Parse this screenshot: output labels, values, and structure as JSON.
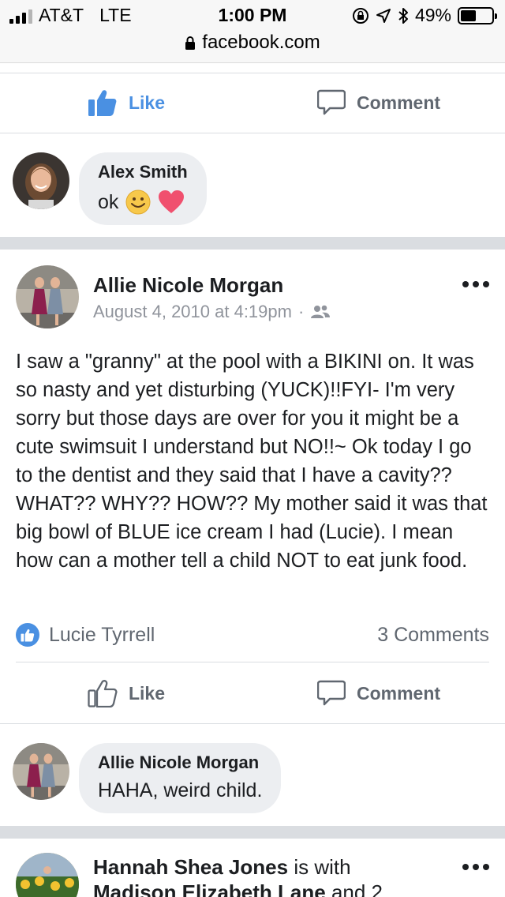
{
  "status_bar": {
    "carrier": "AT&T",
    "network": "LTE",
    "time": "1:00 PM",
    "battery": "49%",
    "battery_level": 0.49
  },
  "browser": {
    "url": "facebook.com"
  },
  "top_actions": {
    "like_label": "Like",
    "comment_label": "Comment"
  },
  "comment_1": {
    "author": "Alex Smith",
    "text": "ok",
    "emojis": [
      "smiley-emoji",
      "heart-emoji"
    ]
  },
  "post": {
    "author": "Allie Nicole Morgan",
    "timestamp": "August 4, 2010 at 4:19pm",
    "separator": "·",
    "audience_icon": "friends-icon",
    "body": "I saw a \"granny\" at the pool with a BIKINI on. It was so nasty and yet disturbing (YUCK)!!FYI- I'm very sorry but those days are over for you it might be a cute swimsuit I understand but NO!!~ Ok today I go to the dentist and they said that I have a cavity?? WHAT?? WHY?? HOW?? My mother said it was that big bowl of BLUE ice cream I had (Lucie). I mean how can a mother tell a child NOT to eat junk food.",
    "liked_by": "Lucie Tyrrell",
    "comments_count": "3 Comments",
    "like_label": "Like",
    "comment_label": "Comment"
  },
  "comment_2": {
    "author": "Allie Nicole Morgan",
    "text": "HAHA, weird child."
  },
  "next_post": {
    "author": "Hannah Shea Jones",
    "connector": "is with",
    "tagged": "Madison Elizabeth Lane",
    "tail": "and 2"
  },
  "colors": {
    "facebook_blue": "#4a90e2",
    "text_primary": "#1c1e21",
    "text_secondary": "#606770",
    "bubble_bg": "#eceef1",
    "separator": "#dadde1",
    "heart": "#f0506e",
    "emoji_yellow": "#f7c84b"
  }
}
